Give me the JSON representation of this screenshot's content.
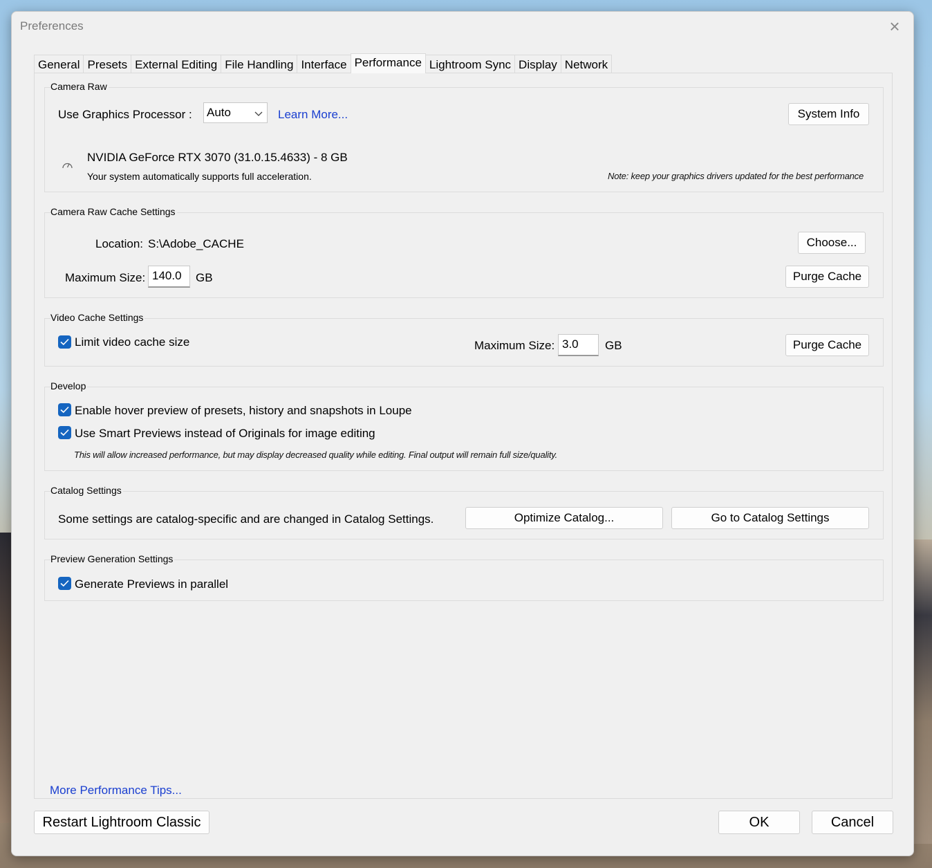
{
  "window": {
    "title": "Preferences"
  },
  "tabs": [
    {
      "label": "General"
    },
    {
      "label": "Presets"
    },
    {
      "label": "External Editing"
    },
    {
      "label": "File Handling"
    },
    {
      "label": "Interface"
    },
    {
      "label": "Performance",
      "active": true
    },
    {
      "label": "Lightroom Sync"
    },
    {
      "label": "Display"
    },
    {
      "label": "Network"
    }
  ],
  "camera_raw": {
    "title": "Camera Raw",
    "gpu_label": "Use Graphics Processor :",
    "gpu_value": "Auto",
    "learn_more": "Learn More...",
    "system_info": "System Info",
    "gpu_name": "NVIDIA GeForce RTX 3070 (31.0.15.4633) - 8 GB",
    "gpu_status": "Your system automatically supports full acceleration.",
    "note": "Note: keep your graphics drivers updated for the best performance",
    "status_icon": "gauge-icon"
  },
  "camera_raw_cache": {
    "title": "Camera Raw Cache Settings",
    "location_label": "Location:",
    "location_value": "S:\\Adobe_CACHE",
    "choose": "Choose...",
    "max_size_label": "Maximum Size:",
    "max_size_value": "140.0",
    "unit": "GB",
    "purge": "Purge Cache"
  },
  "video_cache": {
    "title": "Video Cache Settings",
    "limit_label": "Limit video cache size",
    "limit_checked": true,
    "max_size_label": "Maximum Size:",
    "max_size_value": "3.0",
    "unit": "GB",
    "purge": "Purge Cache"
  },
  "develop": {
    "title": "Develop",
    "hover_label": "Enable hover preview of presets, history and snapshots in Loupe",
    "hover_checked": true,
    "smart_label": "Use Smart Previews instead of Originals for image editing",
    "smart_checked": true,
    "smart_note": "This will allow increased performance, but may display decreased quality while editing. Final output will remain full size/quality."
  },
  "catalog": {
    "title": "Catalog Settings",
    "text": "Some settings are catalog-specific and are changed in Catalog Settings.",
    "optimize": "Optimize Catalog...",
    "goto": "Go to Catalog Settings"
  },
  "preview_generation": {
    "title": "Preview Generation Settings",
    "parallel_label": "Generate Previews in parallel",
    "parallel_checked": true
  },
  "footer": {
    "tips": "More Performance Tips...",
    "restart": "Restart Lightroom Classic",
    "ok": "OK",
    "cancel": "Cancel"
  },
  "colors": {
    "accent": "#1565c0",
    "link": "#1a3fd0",
    "dialog_bg": "#f0f0f0"
  }
}
